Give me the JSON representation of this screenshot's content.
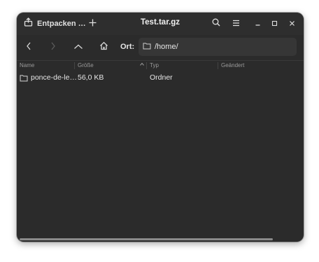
{
  "header": {
    "extract_label": "Entpacken …",
    "title": "Test.tar.gz",
    "icons": [
      "extract-icon",
      "add-icon",
      "search-icon",
      "menu-icon",
      "minimize-icon",
      "maximize-icon",
      "close-icon"
    ]
  },
  "toolbar": {
    "location_label": "Ort:",
    "location_value": "/home/",
    "icons": [
      "back-icon",
      "forward-icon",
      "up-icon",
      "home-icon",
      "folder-icon"
    ]
  },
  "columns": [
    {
      "label": "Name"
    },
    {
      "label": "Größe"
    },
    {
      "label": "Typ"
    },
    {
      "label": "Geändert"
    }
  ],
  "rows": [
    {
      "name": "ponce-de-le…",
      "size": "56,0 KB",
      "type": "Ordner",
      "modified": ""
    }
  ],
  "colors": {
    "window_bg": "#2b2b2b",
    "headerbar_bg": "#2e2e2e",
    "entry_bg": "#363636",
    "text": "#e6e6e6",
    "muted_text": "#9a9a9a"
  }
}
